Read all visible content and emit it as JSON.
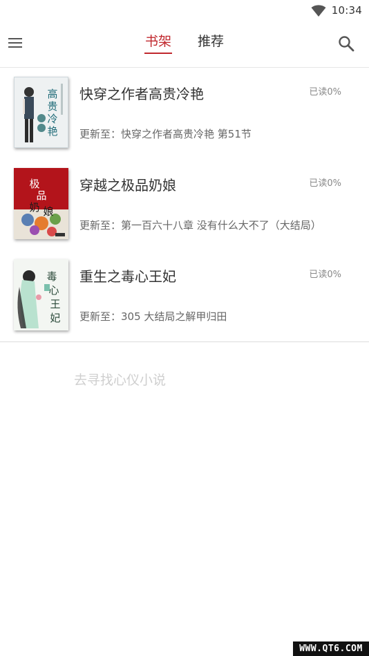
{
  "status_bar": {
    "time": "10:34",
    "icons": [
      "wifi-icon"
    ]
  },
  "header": {
    "menu_icon": "menu-icon",
    "tabs": [
      {
        "label": "书架",
        "active": true
      },
      {
        "label": "推荐",
        "active": false
      }
    ],
    "search_icon": "search-icon",
    "accent_color": "#c0272d"
  },
  "books": [
    {
      "title": "快穿之作者高贵冷艳",
      "progress": "已读0%",
      "update": "更新至：快穿之作者高贵冷艳 第51节",
      "cover_text": "高贵冷艳"
    },
    {
      "title": "穿越之极品奶娘",
      "progress": "已读0%",
      "update": "更新至：第一百六十八章 没有什么大不了（大结局）",
      "cover_text": "极品奶娘"
    },
    {
      "title": "重生之毒心王妃",
      "progress": "已读0%",
      "update": "更新至：305 大结局之解甲归田",
      "cover_text": "毒心王妃"
    }
  ],
  "find_more": "去寻找心仪小说",
  "watermark": "WWW.QT6.COM"
}
